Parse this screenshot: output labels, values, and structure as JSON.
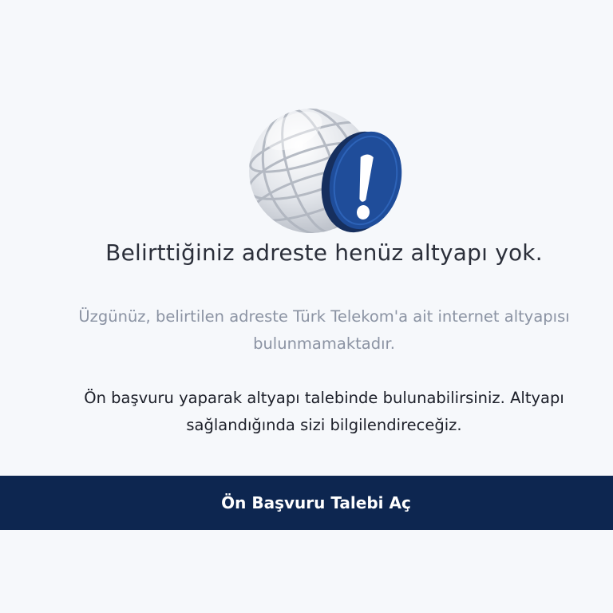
{
  "icon": "globe-with-exclamation-badge-icon",
  "title": "Belirttiğiniz adreste henüz altyapı yok.",
  "description": {
    "line1": "Üzgünüz, belirtilen adreste Türk Telekom'a ait internet altyapısı",
    "line2": "bulunmamaktadır."
  },
  "info": {
    "line1": "Ön başvuru yaparak altyapı talebinde bulunabilirsiniz. Altyapı",
    "line2": "sağlandığında sizi bilgilendireceğiz."
  },
  "cta": {
    "label": "Ön Başvuru Talebi Aç"
  },
  "colors": {
    "background": "#f6f8fb",
    "primary": "#0d2650",
    "badge": "#1f4d9a",
    "muted_text": "#8b93a3"
  }
}
